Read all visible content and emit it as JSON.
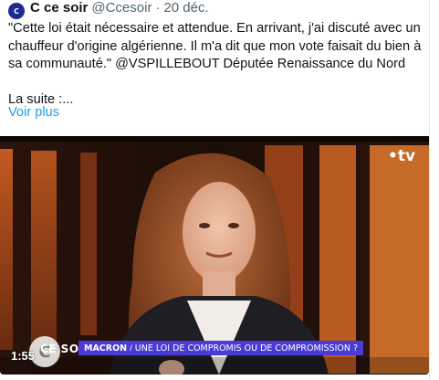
{
  "tweet": {
    "avatar_text": "C",
    "author_name": "C ce soir",
    "handle": "@Ccesoir",
    "separator": "·",
    "date": "20 déc.",
    "text": "\"Cette loi était nécessaire et attendue. En arrivant, j'ai discuté avec un chauffeur d'origine algérienne. Il m'a dit que mon vote faisait du bien à sa communauté.\" @VSPILLEBOUT Députée Renaissance du Nord\n\nLa suite :...",
    "show_more": "Voir plus"
  },
  "video": {
    "channel_logo": "•tv",
    "show_logo_letter": "C",
    "show_name": "CE SOIR",
    "bandeau_keyword": "MACRON",
    "bandeau_separator": "/",
    "bandeau_title": "UNE LOI DE COMPROMIS OU DE COMPROMISSION ?",
    "duration": "1:55"
  },
  "colors": {
    "link": "#1d9bf0",
    "muted": "#536471",
    "bandeau": "#4a3bd6"
  }
}
